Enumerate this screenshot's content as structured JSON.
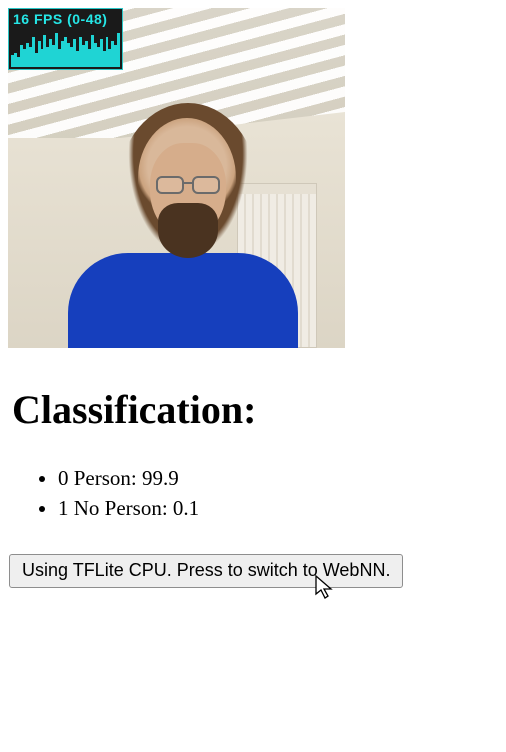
{
  "fps": {
    "label": "16 FPS (0-48)",
    "bars": [
      12,
      14,
      10,
      22,
      18,
      24,
      20,
      30,
      14,
      26,
      18,
      32,
      20,
      28,
      22,
      34,
      18,
      26,
      30,
      24,
      20,
      28,
      16,
      30,
      22,
      26,
      18,
      32,
      24,
      20,
      28,
      16,
      30,
      18,
      26,
      22,
      34
    ]
  },
  "heading": "Classification:",
  "results": [
    {
      "label": "0 Person",
      "score": "99.9"
    },
    {
      "label": "1 No Person",
      "score": "0.1"
    }
  ],
  "button_label": "Using TFLite CPU. Press to switch to WebNN."
}
